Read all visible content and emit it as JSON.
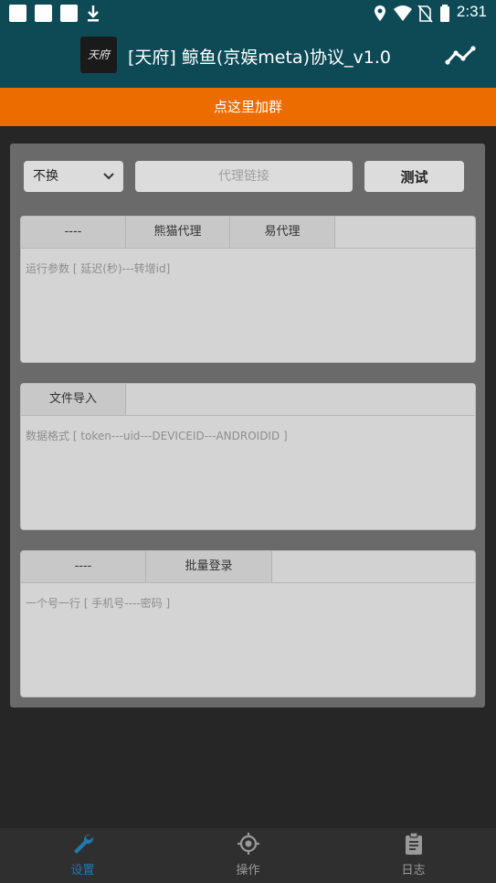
{
  "status_bar": {
    "time": "2:31",
    "left_icons": [
      "app-notification-icon",
      "app-notification-icon",
      "app-notification-icon",
      "download-icon"
    ],
    "right_icons": [
      "location-icon",
      "wifi-icon",
      "no-sim-icon",
      "battery-icon"
    ]
  },
  "app_bar": {
    "logo_text": "天府",
    "title": "[天府] 鲸鱼(京娱meta)协议_v1.0",
    "action_icon": "trending-chart-icon"
  },
  "banner": {
    "label": "点这里加群"
  },
  "proxy": {
    "select_value": "不换",
    "link_placeholder": "代理链接",
    "test_label": "测试"
  },
  "section1": {
    "tabs": [
      "----",
      "熊猫代理",
      "易代理"
    ],
    "placeholder": "运行参数 [ 延迟(秒)---转增id]"
  },
  "section2": {
    "tabs": [
      "文件导入"
    ],
    "placeholder": "数据格式 [ token---uid---DEVICEID---ANDROIDID ]"
  },
  "section3": {
    "tabs": [
      "----",
      "批量登录"
    ],
    "placeholder": "一个号一行 [ 手机号----密码 ]"
  },
  "bottom_nav": {
    "items": [
      {
        "label": "设置",
        "icon": "wrench-icon",
        "active": true
      },
      {
        "label": "操作",
        "icon": "target-icon",
        "active": false
      },
      {
        "label": "日志",
        "icon": "clipboard-icon",
        "active": false
      }
    ]
  },
  "colors": {
    "appbar": "#0d4a56",
    "banner": "#ec6c00",
    "nav_active": "#1e7ab0",
    "nav_inactive": "#9a9a9a"
  }
}
